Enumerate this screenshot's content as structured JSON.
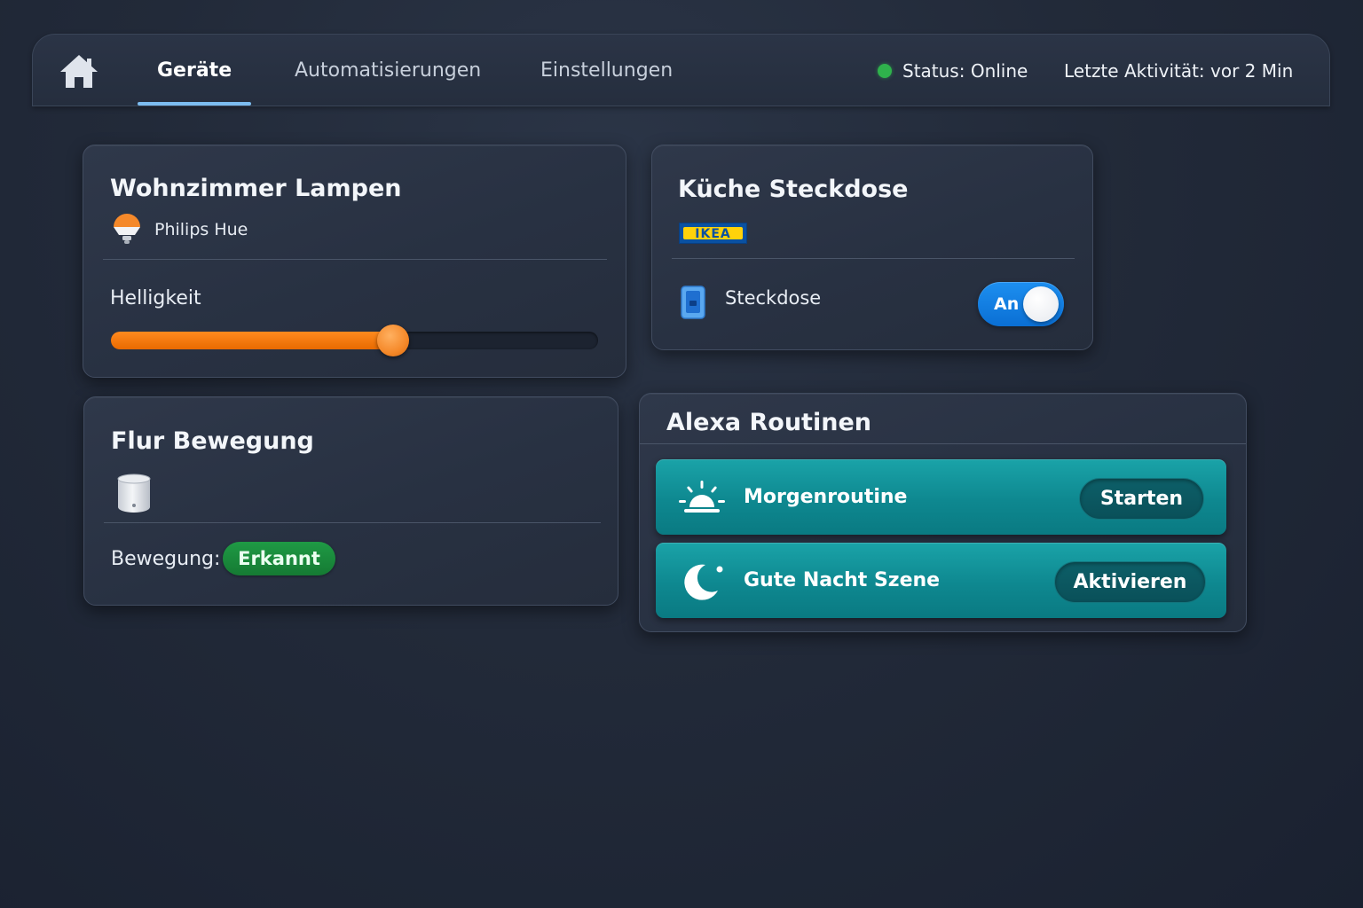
{
  "nav": {
    "tabs": [
      {
        "label": "Geräte",
        "active": true
      },
      {
        "label": "Automatisierungen",
        "active": false
      },
      {
        "label": "Einstellungen",
        "active": false
      }
    ],
    "status": "Status: Online",
    "status_color": "#2fb24c",
    "last_activity": "Letzte Aktivität: vor 2 Min",
    "home_icon": "home-icon"
  },
  "devices": {
    "lamps": {
      "title": "Wohnzimmer Lampen",
      "brand": "Philips Hue",
      "brand_icon": "lightbulb-icon",
      "brightness_label": "Helligkeit",
      "brightness_value": 0.58,
      "accent": "#f5892a"
    },
    "kitchen": {
      "title": "Küche Steckdose",
      "brand_logo": "IKEA",
      "outlet_label": "Steckdose",
      "outlet_icon": "outlet-icon",
      "toggle_label": "An",
      "toggle_on": true,
      "accent": "#1d8ff0"
    },
    "hall": {
      "title": "Flur Bewegung",
      "sensor_icon": "motion-sensor-icon",
      "motion_label": "Bewegung:",
      "motion_status": "Erkannt",
      "status_color": "#1f9a45"
    }
  },
  "alexa": {
    "title": "Alexa Routinen",
    "routines": [
      {
        "label": "Morgenroutine",
        "button": "Starten",
        "icon": "sunrise-icon"
      },
      {
        "label": "Gute Nacht Szene",
        "button": "Aktivieren",
        "icon": "moon-icon"
      }
    ],
    "accent": "#0e8890"
  }
}
